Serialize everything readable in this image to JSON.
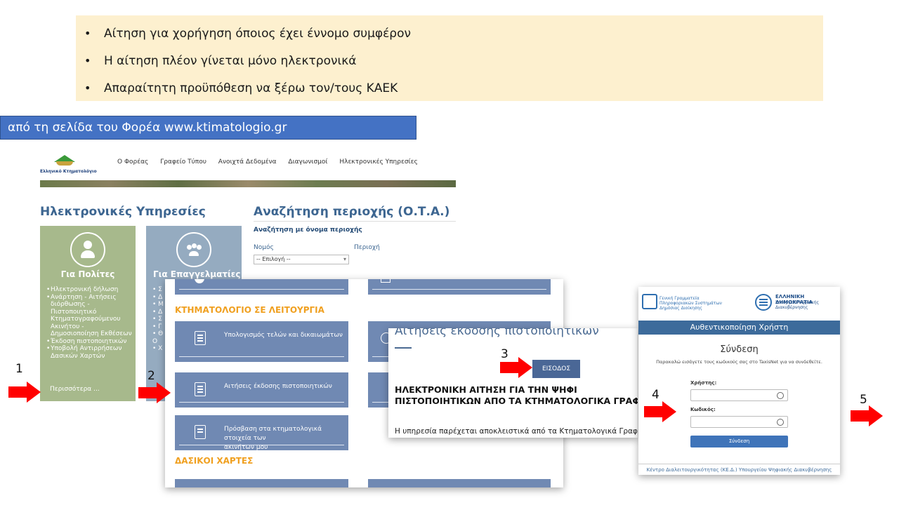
{
  "bullets": [
    "Αίτηση για χορήγηση όποιος έχει έννομο συμφέρον",
    "Η αίτηση πλέον γίνεται μόνο ηλεκτρονικά",
    "Απαραίτητη προϋπόθεση να ξέρω τον/τους ΚΑΕΚ"
  ],
  "source_banner": "από τη σελίδα του Φορέα www.ktimatologio.gr",
  "site": {
    "logo_text": "Ελληνικό Κτηματολόγιο",
    "nav": [
      "Ο Φορέας",
      "Γραφείο Τύπου",
      "Ανοιχτά Δεδομένα",
      "Διαγωνισμοί",
      "Ηλεκτρονικές Υπηρεσίες"
    ],
    "e_services_heading": "Ηλεκτρονικές Υπηρεσίες",
    "area_search_heading": "Αναζήτηση περιοχής (Ο.Τ.Α.)",
    "area_search_sub": "Αναζήτηση με όνομα περιοχής",
    "nomos_label": "Νομός",
    "perioxi_label": "Περιοχή",
    "select_value": "-- Επιλογή --",
    "citizens": {
      "title": "Για Πολίτες",
      "items": [
        "Ηλεκτρονική δήλωση",
        "Ανάρτηση - Αιτήσεις διόρθωσης - Πιστοποιητικό Κτηματογραφούμενου Ακινήτου - Δημοσιοποίηση Εκθέσεων",
        "Έκδοση πιστοποιητικών",
        "Υποβολή Αντιρρήσεων Δασικών Χαρτών"
      ],
      "more": "Περισσότερα ..."
    },
    "professionals": {
      "title": "Για Επαγγελματίες",
      "stubs": [
        "• Σ",
        "• Δ",
        "• Μ",
        "• Δ",
        "• Σ",
        "• Γ",
        "• Θ",
        "  Ο",
        "• Χ"
      ]
    }
  },
  "services": {
    "operational_heading": "ΚΤΗΜΑΤΟΛΟΓΙΟ ΣΕ ΛΕΙΤΟΥΡΓΙΑ",
    "fees": "Υπολογισμός τελών και δικαιωμάτων",
    "certificates": "Αιτήσεις έκδοσης πιστοποιητικών",
    "access_line1": "Πρόσβαση στα κτηματολογικά στοιχεία των",
    "access_line2": "ακινήτων μου",
    "forest_heading": "ΔΑΣΙΚΟΙ ΧΑΡΤΕΣ"
  },
  "certificate_page": {
    "title": "Αιτήσεις έκδοσης πιστοποιητικών",
    "login_button": "ΕΙΣΟΔΟΣ",
    "heading_line1": "ΗΛΕΚΤΡΟΝΙΚΗ      ΑΙΤΗΣΗ      ΓΙΑ      ΤΗΝ      ΨΗΦΙ",
    "heading_line2": "ΠΙΣΤΟΠΟΙΗΤΙΚΩΝ ΑΠΟ ΤΑ ΚΤΗΜΑΤΟΛΟΓΙΚΑ ΓΡΑΦΕ",
    "body": "Η υπηρεσία παρέχεται αποκλειστικά από τα Κτηματολογικά Γραφεία κ"
  },
  "login": {
    "gsis_line1": "Γενική Γραμματεία",
    "gsis_line2": "Πληροφοριακών Συστημάτων",
    "gsis_line3": "Δημόσιας Διοίκησης",
    "gov_title": "ΕΛΛΗΝΙΚΗ ΔΗΜΟΚΡΑΤΙΑ",
    "gov_sub1": "Υπουργείο Ψηφιακής",
    "gov_sub2": "Διακυβέρνησης",
    "band": "Αυθεντικοποίηση Χρήστη",
    "heading": "Σύνδεση",
    "help": "Παρακαλώ εισάγετε τους κωδικούς σας στο TaxisNet για να συνδεθείτε.",
    "user_label": "Χρήστης:",
    "pass_label": "Κωδικός:",
    "submit": "Σύνδεση",
    "footer": "Κέντρο Διαλειτουργικότητας (ΚΕ.Δ.) Υπουργείου Ψηφιακής Διακυβέρνησης"
  },
  "steps": [
    "1",
    "2",
    "3",
    "4",
    "5"
  ],
  "colors": {
    "arrow": "#ff0000",
    "banner": "#4472c4",
    "bullets_bg": "#fdf0cf",
    "tile": "#7089b3"
  }
}
